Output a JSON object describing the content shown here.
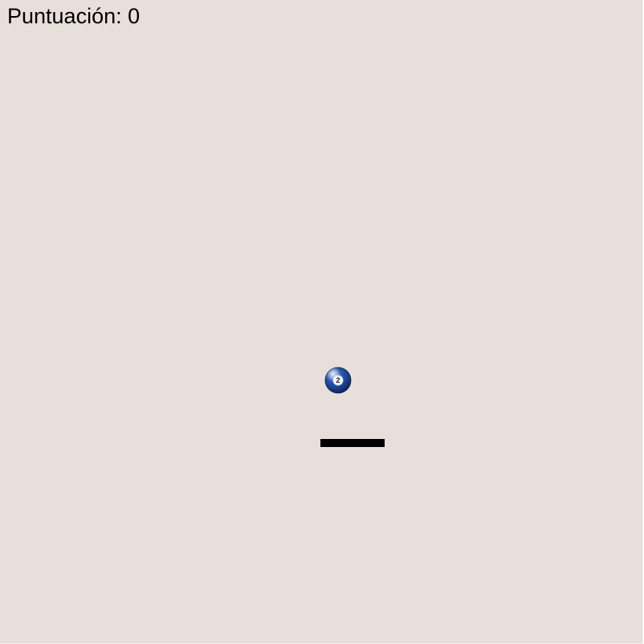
{
  "game": {
    "score_label": "Puntuación: 0",
    "ball_number": "2",
    "ball_icon": "billiard-ball-2-icon",
    "colors": {
      "background": "#e8dfda",
      "ball": "#1d4a9a",
      "paddle": "#000000",
      "text": "#000000"
    }
  }
}
